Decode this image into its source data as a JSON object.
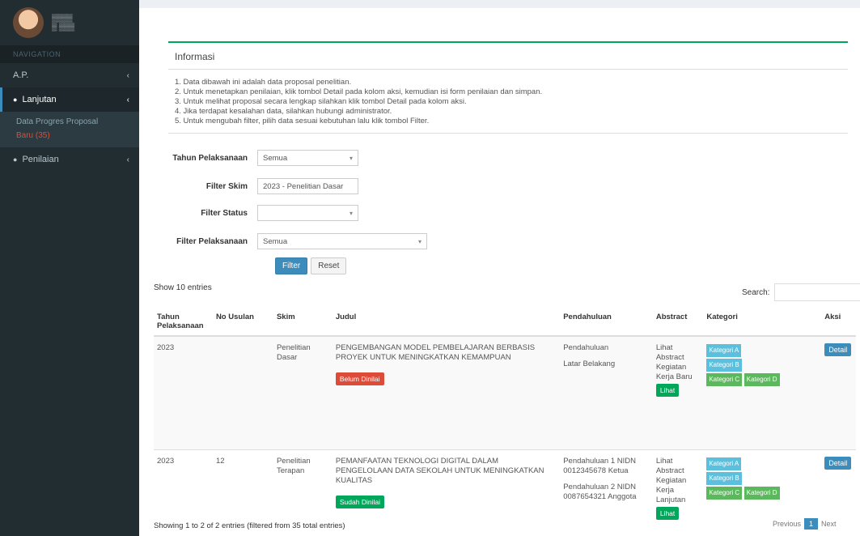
{
  "sidebar": {
    "user_line1": "▒▒▒▒",
    "user_line2": "▒ ▒▒▒",
    "header": "NAVIGATION",
    "items": [
      {
        "label": "A.P.",
        "chev": "‹"
      },
      {
        "label": "Lanjutan",
        "chev": "‹"
      },
      {
        "label": "Penilaian",
        "chev": "‹"
      }
    ],
    "sub_items": [
      "Data Progres Proposal",
      "Baru (35)"
    ]
  },
  "box": {
    "title": "Informasi",
    "lines": [
      "1. Data dibawah ini adalah data proposal penelitian.",
      "2. Untuk menetapkan penilaian, klik tombol Detail pada kolom aksi, kemudian isi form penilaian dan simpan.",
      "3. Untuk melihat proposal secara lengkap silahkan klik tombol Detail pada kolom aksi.",
      "4. Jika terdapat kesalahan data, silahkan hubungi administrator.",
      "5. Untuk mengubah filter, pilih data sesuai kebutuhan lalu klik tombol Filter."
    ]
  },
  "filters": {
    "f1_label": "Tahun Pelaksanaan",
    "f1_value": "Semua",
    "f2_label": "Filter Skim",
    "f2_value": "2023 - Penelitian Dasar",
    "f3_label": "Filter Status",
    "f3_value": "",
    "f4_label": "Filter Pelaksanaan",
    "f4_value": "Semua",
    "btn_filter": "Filter",
    "btn_reset": "Reset"
  },
  "table_controls": {
    "show": "Show 10 entries",
    "search_label": "Search:"
  },
  "table": {
    "headers": [
      "Tahun Pelaksanaan",
      "No Usulan",
      "Skim",
      "Judul",
      "Pendahuluan",
      "Abstract",
      "Kategori",
      "Aksi"
    ],
    "rows": [
      {
        "year": "2023",
        "no": "",
        "skim": "Penelitian Dasar",
        "judul": "PENGEMBANGAN MODEL PEMBELAJARAN BERBASIS PROYEK UNTUK MENINGKATKAN KEMAMPUAN",
        "status": "Belum Dinilai",
        "status_color": "red",
        "pendahuluan_a": "Pendahuluan",
        "pendahuluan_b": "Latar Belakang",
        "abstract": "Lihat Abstract Kegiatan Kerja Baru",
        "abstract_btn": "Lihat",
        "tags": [
          "Kategori A",
          "Kategori B",
          "Kategori C",
          "Kategori D"
        ],
        "aksi": "Detail"
      },
      {
        "year": "2023",
        "no": "12",
        "skim": "Penelitian Terapan",
        "judul": "PEMANFAATAN TEKNOLOGI DIGITAL DALAM PENGELOLAAN DATA SEKOLAH UNTUK MENINGKATKAN KUALITAS",
        "status": "Sudah Dinilai",
        "status_color": "green",
        "pendahuluan_a": "Pendahuluan 1 NIDN 0012345678 Ketua",
        "pendahuluan_b": "Pendahuluan 2 NIDN 0087654321 Anggota",
        "abstract": "Lihat Abstract Kegiatan Kerja Lanjutan",
        "abstract_btn": "Lihat",
        "tags": [
          "Kategori A",
          "Kategori B",
          "Kategori C",
          "Kategori D"
        ],
        "aksi": "Detail"
      }
    ]
  },
  "footer": {
    "info": "Showing 1 to 2 of 2 entries (filtered from 35 total entries)",
    "prev": "Previous",
    "page": "1",
    "next": "Next"
  },
  "colors": {
    "sidebar_bg": "#222d32",
    "accent": "#3c8dbc",
    "success": "#00a65a",
    "danger": "#dd4b39"
  }
}
